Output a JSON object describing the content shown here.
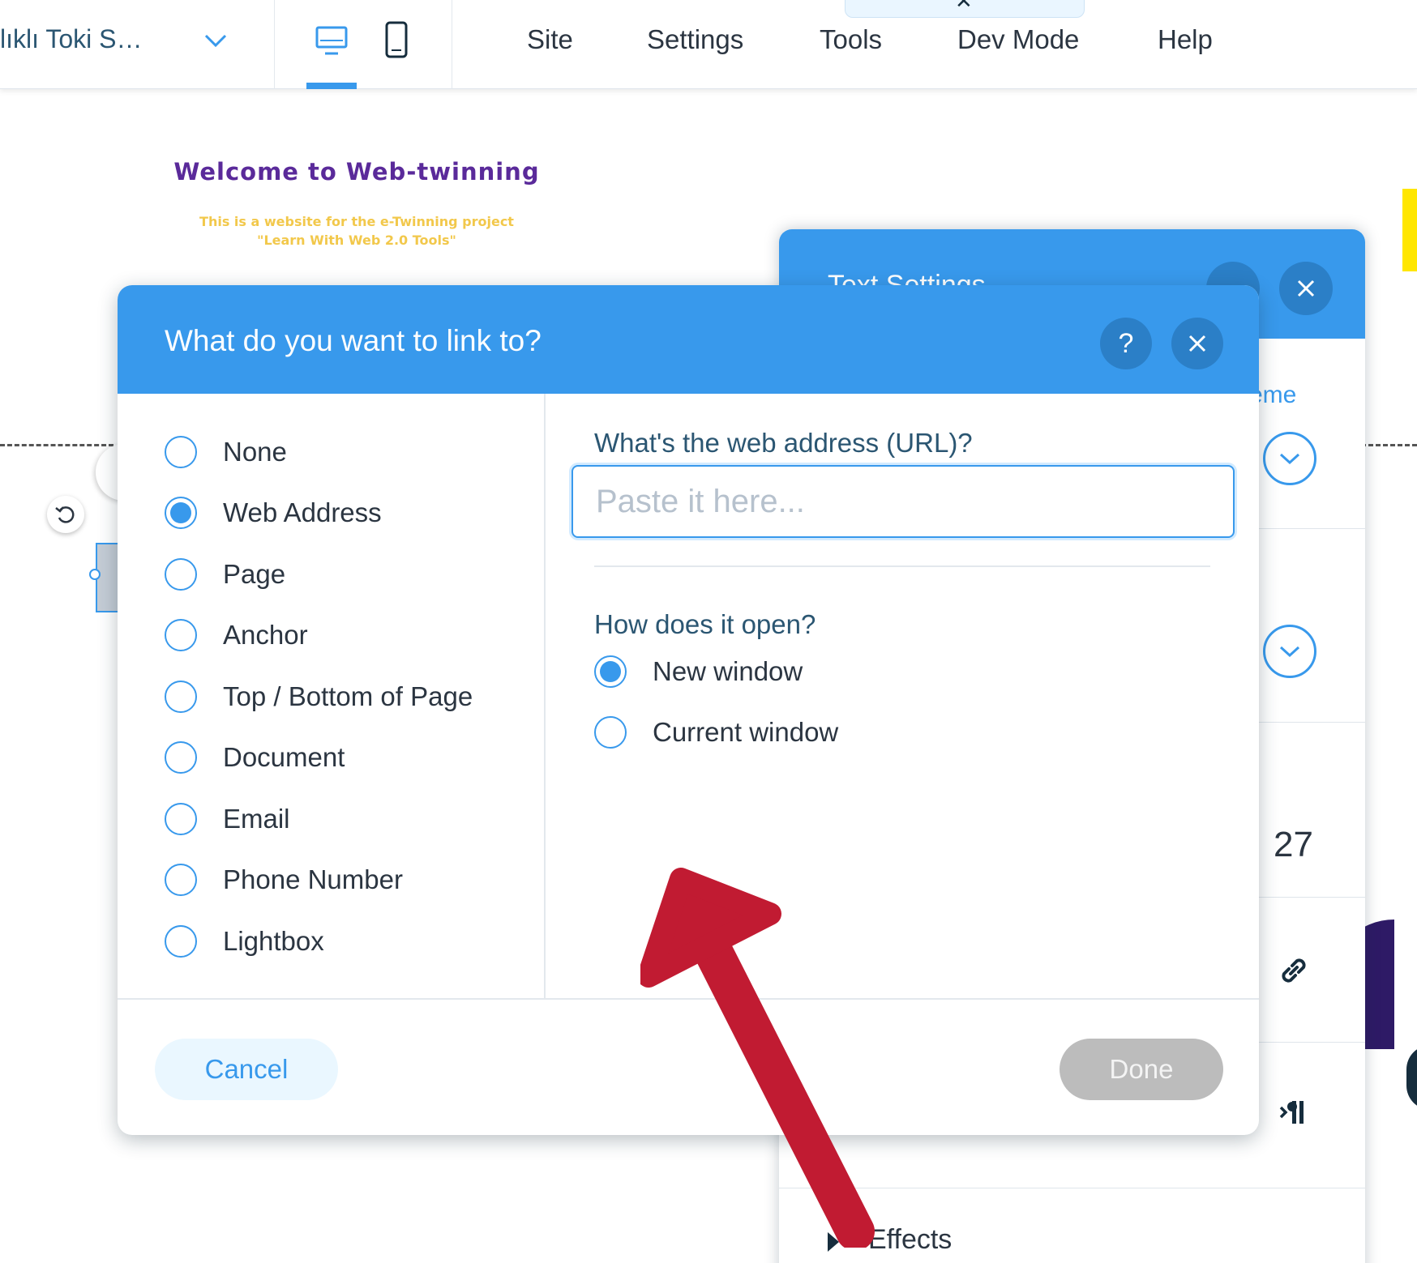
{
  "topbar": {
    "site_name": "lıklı Toki S…",
    "menu": [
      "Site",
      "Settings",
      "Tools",
      "Dev Mode",
      "Help"
    ],
    "bubble_icon": "close-icon"
  },
  "canvas": {
    "welcome_title": "Welcome to Web-twinning",
    "welcome_sub_line1": "This is a website for the e-Twinning project",
    "welcome_sub_line2": "\"Learn With Web 2.0 Tools\""
  },
  "text_settings": {
    "title": "Text Settings",
    "theme_label": "Theme",
    "theme_visible": "eme",
    "number_value": "27",
    "effects_label": "Effects"
  },
  "dialog": {
    "title": "What do you want to link to?",
    "help_label": "?",
    "link_types": [
      {
        "label": "None",
        "selected": false
      },
      {
        "label": "Web Address",
        "selected": true
      },
      {
        "label": "Page",
        "selected": false
      },
      {
        "label": "Anchor",
        "selected": false
      },
      {
        "label": "Top / Bottom of Page",
        "selected": false
      },
      {
        "label": "Document",
        "selected": false
      },
      {
        "label": "Email",
        "selected": false
      },
      {
        "label": "Phone Number",
        "selected": false
      },
      {
        "label": "Lightbox",
        "selected": false
      }
    ],
    "url_label": "What's the web address (URL)?",
    "url_value": "",
    "url_placeholder": "Paste it here...",
    "open_label": "How does it open?",
    "open_options": [
      {
        "label": "New window",
        "selected": true
      },
      {
        "label": "Current window",
        "selected": false
      }
    ],
    "cancel_label": "Cancel",
    "done_label": "Done"
  },
  "colors": {
    "accent": "#3899ec",
    "annotation_arrow": "#c11b32",
    "done_disabled": "#bcbcbc"
  }
}
